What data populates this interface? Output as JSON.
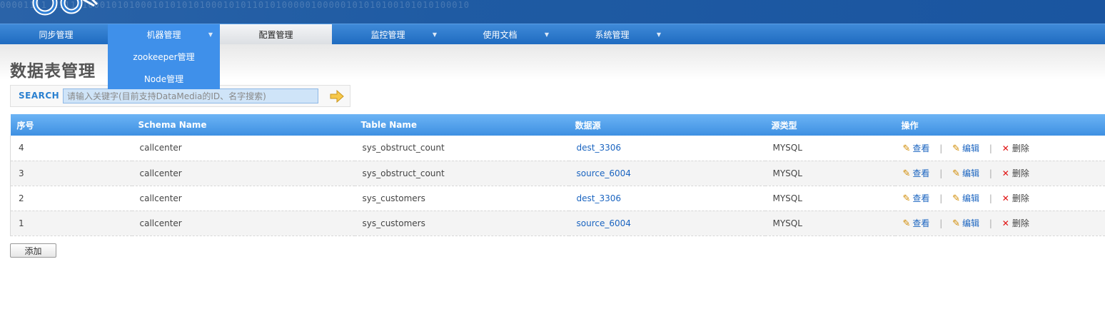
{
  "header": {
    "bits": "00001111 11111100010101000101010101000101011010100000100000101010100101010100010"
  },
  "nav": {
    "items": [
      {
        "label": "同步管理"
      },
      {
        "label": "机器管理"
      },
      {
        "label": "配置管理"
      },
      {
        "label": "监控管理"
      },
      {
        "label": "使用文档"
      },
      {
        "label": "系统管理"
      }
    ],
    "dropdown": [
      {
        "label": "zookeeper管理"
      },
      {
        "label": "Node管理"
      }
    ]
  },
  "page": {
    "title": "数据表管理"
  },
  "search": {
    "label": "SEARCH",
    "placeholder": "请输入关键字(目前支持DataMedia的ID、名字搜索)"
  },
  "table": {
    "headers": [
      "序号",
      "Schema Name",
      "Table Name",
      "数据源",
      "源类型",
      "操作"
    ],
    "rows": [
      {
        "id": "4",
        "schema": "callcenter",
        "table": "sys_obstruct_count",
        "source": "dest_3306",
        "type": "MYSQL"
      },
      {
        "id": "3",
        "schema": "callcenter",
        "table": "sys_obstruct_count",
        "source": "source_6004",
        "type": "MYSQL"
      },
      {
        "id": "2",
        "schema": "callcenter",
        "table": "sys_customers",
        "source": "dest_3306",
        "type": "MYSQL"
      },
      {
        "id": "1",
        "schema": "callcenter",
        "table": "sys_customers",
        "source": "source_6004",
        "type": "MYSQL"
      }
    ],
    "actions": {
      "view": "查看",
      "edit": "编辑",
      "delete": "删除",
      "separator": "|"
    }
  },
  "add_button": "添加",
  "colors": {
    "accent": "#3f90ea",
    "header_bg": "#1f5ba3",
    "link": "#1a64c0",
    "delete_x": "#e01010"
  }
}
